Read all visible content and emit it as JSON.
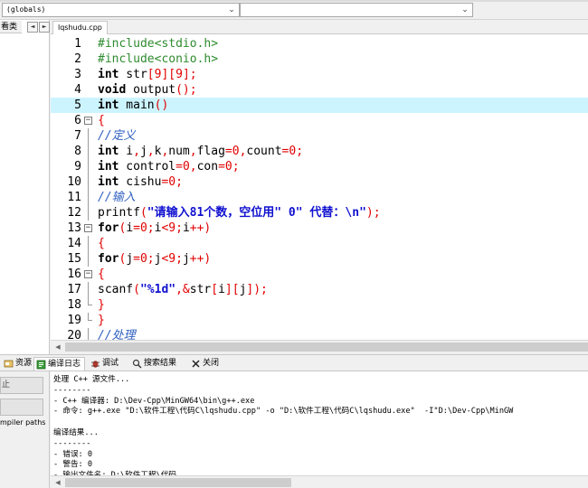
{
  "toolbar": {
    "scope_combo": "(globals)",
    "function_combo": ""
  },
  "left_panel": {
    "tab_label": "看类",
    "nav_prev": "◄",
    "nav_next": "►"
  },
  "editor": {
    "file_tab": "lqshudu.cpp",
    "highlight_line": 5,
    "lines": [
      {
        "n": "1",
        "fold": "",
        "tokens": [
          {
            "c": "pre",
            "t": "#include<stdio.h>"
          }
        ]
      },
      {
        "n": "2",
        "fold": "",
        "tokens": [
          {
            "c": "pre",
            "t": "#include<conio.h>"
          }
        ]
      },
      {
        "n": "3",
        "fold": "",
        "tokens": [
          {
            "c": "kw",
            "t": "int"
          },
          {
            "c": "id",
            "t": " str"
          },
          {
            "c": "sym",
            "t": "["
          },
          {
            "c": "num",
            "t": "9"
          },
          {
            "c": "sym",
            "t": "]["
          },
          {
            "c": "num",
            "t": "9"
          },
          {
            "c": "sym",
            "t": "];"
          }
        ]
      },
      {
        "n": "4",
        "fold": "",
        "tokens": [
          {
            "c": "kw",
            "t": "void"
          },
          {
            "c": "id",
            "t": " output"
          },
          {
            "c": "sym",
            "t": "();"
          }
        ]
      },
      {
        "n": "5",
        "fold": "",
        "tokens": [
          {
            "c": "kw",
            "t": "int"
          },
          {
            "c": "id",
            "t": " main"
          },
          {
            "c": "sym",
            "t": "()"
          }
        ]
      },
      {
        "n": "6",
        "fold": "box",
        "tokens": [
          {
            "c": "sym",
            "t": "{"
          }
        ]
      },
      {
        "n": "7",
        "fold": "line",
        "tokens": [
          {
            "c": "cmt",
            "t": "//定义"
          }
        ]
      },
      {
        "n": "8",
        "fold": "line",
        "tokens": [
          {
            "c": "kw",
            "t": "int"
          },
          {
            "c": "id",
            "t": " i"
          },
          {
            "c": "sym",
            "t": ","
          },
          {
            "c": "id",
            "t": "j"
          },
          {
            "c": "sym",
            "t": ","
          },
          {
            "c": "id",
            "t": "k"
          },
          {
            "c": "sym",
            "t": ","
          },
          {
            "c": "id",
            "t": "num"
          },
          {
            "c": "sym",
            "t": ","
          },
          {
            "c": "id",
            "t": "flag"
          },
          {
            "c": "sym",
            "t": "="
          },
          {
            "c": "num",
            "t": "0"
          },
          {
            "c": "sym",
            "t": ","
          },
          {
            "c": "id",
            "t": "count"
          },
          {
            "c": "sym",
            "t": "="
          },
          {
            "c": "num",
            "t": "0"
          },
          {
            "c": "sym",
            "t": ";"
          }
        ]
      },
      {
        "n": "9",
        "fold": "line",
        "tokens": [
          {
            "c": "kw",
            "t": "int"
          },
          {
            "c": "id",
            "t": " control"
          },
          {
            "c": "sym",
            "t": "="
          },
          {
            "c": "num",
            "t": "0"
          },
          {
            "c": "sym",
            "t": ","
          },
          {
            "c": "id",
            "t": "con"
          },
          {
            "c": "sym",
            "t": "="
          },
          {
            "c": "num",
            "t": "0"
          },
          {
            "c": "sym",
            "t": ";"
          }
        ]
      },
      {
        "n": "10",
        "fold": "line",
        "tokens": [
          {
            "c": "kw",
            "t": "int"
          },
          {
            "c": "id",
            "t": " cishu"
          },
          {
            "c": "sym",
            "t": "="
          },
          {
            "c": "num",
            "t": "0"
          },
          {
            "c": "sym",
            "t": ";"
          }
        ]
      },
      {
        "n": "11",
        "fold": "line",
        "tokens": [
          {
            "c": "cmt",
            "t": "//输入"
          }
        ]
      },
      {
        "n": "12",
        "fold": "line",
        "tokens": [
          {
            "c": "id",
            "t": "printf"
          },
          {
            "c": "sym",
            "t": "("
          },
          {
            "c": "str",
            "t": "\"请输入81个数，空位用\" 0\" 代替：\\n\""
          },
          {
            "c": "sym",
            "t": ");"
          }
        ]
      },
      {
        "n": "13",
        "fold": "box",
        "tokens": [
          {
            "c": "kw",
            "t": "for"
          },
          {
            "c": "sym",
            "t": "("
          },
          {
            "c": "id",
            "t": "i"
          },
          {
            "c": "sym",
            "t": "="
          },
          {
            "c": "num",
            "t": "0"
          },
          {
            "c": "sym",
            "t": ";"
          },
          {
            "c": "id",
            "t": "i"
          },
          {
            "c": "sym",
            "t": "<"
          },
          {
            "c": "num",
            "t": "9"
          },
          {
            "c": "sym",
            "t": ";"
          },
          {
            "c": "id",
            "t": "i"
          },
          {
            "c": "sym",
            "t": "++)"
          }
        ]
      },
      {
        "n": "14",
        "fold": "line",
        "tokens": [
          {
            "c": "sym",
            "t": "{"
          }
        ]
      },
      {
        "n": "15",
        "fold": "line",
        "tokens": [
          {
            "c": "kw",
            "t": "for"
          },
          {
            "c": "sym",
            "t": "("
          },
          {
            "c": "id",
            "t": "j"
          },
          {
            "c": "sym",
            "t": "="
          },
          {
            "c": "num",
            "t": "0"
          },
          {
            "c": "sym",
            "t": ";"
          },
          {
            "c": "id",
            "t": "j"
          },
          {
            "c": "sym",
            "t": "<"
          },
          {
            "c": "num",
            "t": "9"
          },
          {
            "c": "sym",
            "t": ";"
          },
          {
            "c": "id",
            "t": "j"
          },
          {
            "c": "sym",
            "t": "++)"
          }
        ]
      },
      {
        "n": "16",
        "fold": "box",
        "tokens": [
          {
            "c": "sym",
            "t": "{"
          }
        ]
      },
      {
        "n": "17",
        "fold": "line",
        "tokens": [
          {
            "c": "id",
            "t": "scanf"
          },
          {
            "c": "sym",
            "t": "("
          },
          {
            "c": "str",
            "t": "\"%1d\""
          },
          {
            "c": "sym",
            "t": ",&"
          },
          {
            "c": "id",
            "t": "str"
          },
          {
            "c": "sym",
            "t": "["
          },
          {
            "c": "id",
            "t": "i"
          },
          {
            "c": "sym",
            "t": "]["
          },
          {
            "c": "id",
            "t": "j"
          },
          {
            "c": "sym",
            "t": "]);"
          }
        ]
      },
      {
        "n": "18",
        "fold": "end",
        "tokens": [
          {
            "c": "sym",
            "t": "}"
          }
        ]
      },
      {
        "n": "19",
        "fold": "end",
        "tokens": [
          {
            "c": "sym",
            "t": "}"
          }
        ]
      },
      {
        "n": "20",
        "fold": "line",
        "tokens": [
          {
            "c": "cmt",
            "t": "//处理"
          }
        ]
      }
    ]
  },
  "bottom": {
    "tabs": [
      {
        "icon": "resources-icon",
        "label": "资源"
      },
      {
        "icon": "compile-log-icon",
        "label": "编译日志"
      },
      {
        "icon": "debug-icon",
        "label": "调试"
      },
      {
        "icon": "search-results-icon",
        "label": "搜索结果"
      },
      {
        "icon": "close-icon",
        "label": "关闭"
      }
    ],
    "side_button_1": "止",
    "side_button_2": "",
    "side_label": "mpiler paths",
    "output_lines": [
      "处理 C++ 源文件...",
      "--------",
      "- C++ 编译器: D:\\Dev-Cpp\\MinGW64\\bin\\g++.exe",
      "- 命令: g++.exe \"D:\\软件工程\\代码C\\lqshudu.cpp\" -o \"D:\\软件工程\\代码C\\lqshudu.exe\"  -I\"D:\\Dev-Cpp\\MinGW",
      "",
      "编译结果...",
      "--------",
      "- 错误: 0",
      "- 警告: 0",
      "- 输出文件名: D:\\软件工程\\代码"
    ]
  }
}
